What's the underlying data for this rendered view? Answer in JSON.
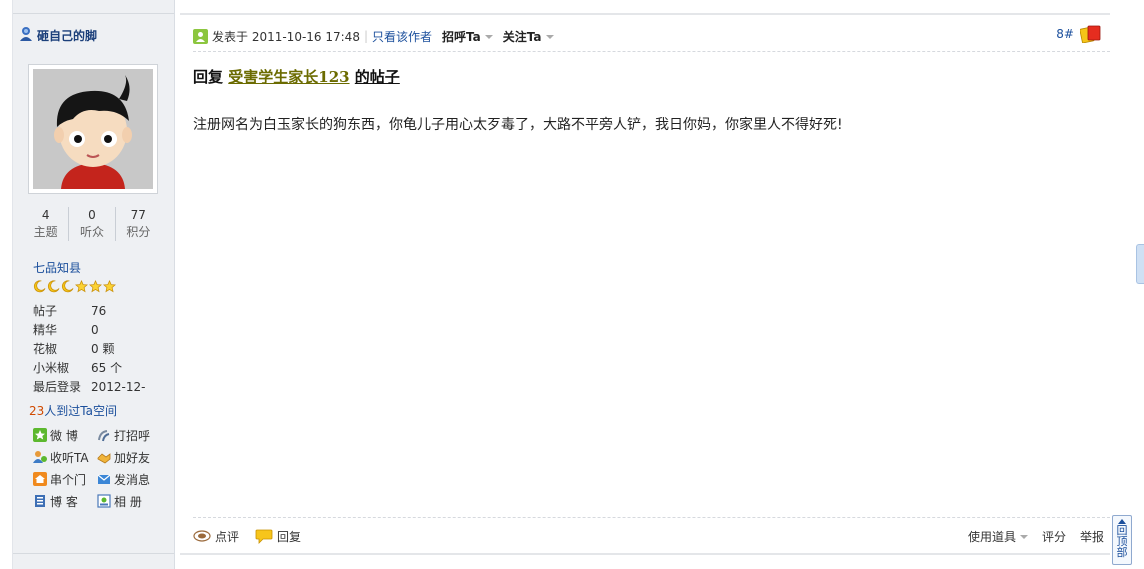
{
  "author": {
    "name": "砸自己的脚",
    "stats": [
      {
        "num": "4",
        "label": "主题"
      },
      {
        "num": "0",
        "label": "听众"
      },
      {
        "num": "77",
        "label": "积分"
      }
    ],
    "rank": "七品知县",
    "info": [
      {
        "k": "帖子",
        "v": "76"
      },
      {
        "k": "精华",
        "v": "0"
      },
      {
        "k": "花椒",
        "v": "0 颗"
      },
      {
        "k": "小米椒",
        "v": "65 个"
      },
      {
        "k": "最后登录",
        "v": "2012-12-"
      }
    ],
    "visited_count": "23",
    "visited_text": "人到过Ta空间",
    "actions": [
      {
        "label": "微 博",
        "icon": "weibo-icon"
      },
      {
        "label": "打招呼",
        "icon": "greet-icon"
      },
      {
        "label": "收听TA",
        "icon": "follow-icon"
      },
      {
        "label": "加好友",
        "icon": "add-friend-icon"
      },
      {
        "label": "串个门",
        "icon": "home-icon"
      },
      {
        "label": "发消息",
        "icon": "mail-icon"
      },
      {
        "label": "博 客",
        "icon": "blog-icon"
      },
      {
        "label": "相 册",
        "icon": "album-icon"
      }
    ]
  },
  "post": {
    "posted_at": "发表于 2011-10-16 17:48",
    "only_author": "只看该作者",
    "greet": "招呼Ta",
    "follow": "关注Ta",
    "floor": "8#",
    "title_prefix": "回复",
    "title_link": "受害学生家长123",
    "title_suffix": "的帖子",
    "content": "注册网名为白玉家长的狗东西，你龟儿子用心太歹毒了，大路不平旁人铲，我日你妈，你家里人不得好死!",
    "footer": {
      "comment": "点评",
      "reply": "回复",
      "tools": "使用道具",
      "rate": "评分",
      "report": "举报"
    }
  },
  "back_to_top": "回顶部"
}
